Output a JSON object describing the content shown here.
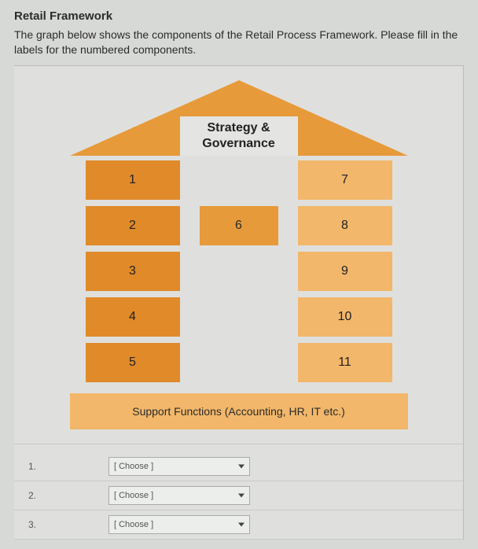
{
  "title": "Retail Framework",
  "subtitle": "The graph below shows the components of the Retail Process Framework. Please fill in the labels for the numbered components.",
  "roof": "Strategy & Governance",
  "left_col": [
    "1",
    "2",
    "3",
    "4",
    "5"
  ],
  "middle": "6",
  "right_col": [
    "7",
    "8",
    "9",
    "10",
    "11"
  ],
  "foundation": "Support Functions (Accounting, HR, IT etc.)",
  "answers": [
    {
      "num": "1.",
      "placeholder": "[ Choose ]"
    },
    {
      "num": "2.",
      "placeholder": "[ Choose ]"
    },
    {
      "num": "3.",
      "placeholder": "[ Choose ]"
    }
  ]
}
